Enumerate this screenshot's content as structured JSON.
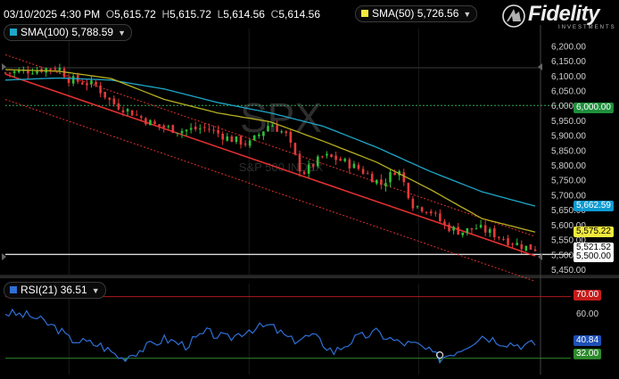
{
  "header": {
    "datetime": "03/10/2025 4:30 PM",
    "open_label": "O",
    "open": "5,615.72",
    "high_label": "H",
    "high": "5,615.72",
    "low_label": "L",
    "low": "5,614.56",
    "close_label": "C",
    "close": "5,614.56"
  },
  "indicators": {
    "sma50": {
      "label": "SMA(50)",
      "value": "5,726.56",
      "color": "#f2ea3c"
    },
    "sma100": {
      "label": "SMA(100)",
      "value": "5,788.59",
      "color": "#1ea7c9"
    },
    "rsi": {
      "label": "RSI(21)",
      "value": "36.51",
      "color": "#2f6fd6"
    }
  },
  "brand": {
    "name": "Fidelity",
    "tagline": "INVESTMENTS"
  },
  "watermark": {
    "symbol": "SPX",
    "name": "S&P 500 INDEX"
  },
  "price_tags": {
    "level": "6,000.00",
    "sma100": "5,662.59",
    "sma50": "5,575.22",
    "last": "5,521.52",
    "support": "5,500.00"
  },
  "rsi_tags": {
    "overbought": "70.00",
    "current": "40.84",
    "oversold": "32.00"
  },
  "colors": {
    "up": "#2fbf3a",
    "down": "#e23a3a",
    "trend": "#e03030",
    "level_tag": "#1f8f3c",
    "sma100_tag": "#0e9ad1",
    "sma50_tag": "#f2ea3c",
    "overbought_tag": "#c61b1b",
    "oversold_tag": "#2d8a2d"
  },
  "chart_data": {
    "type": "candlestick",
    "price_axis": {
      "ticks": [
        6200,
        6150,
        6100,
        6050,
        6000,
        5950,
        5900,
        5850,
        5800,
        5750,
        5700,
        5650,
        5600,
        5550,
        5500,
        5450
      ],
      "tick_labels": [
        "6,200.00",
        "6,150.00",
        "6,100.00",
        "6,050.00",
        "6,000.00",
        "5,950.00",
        "5,900.00",
        "5,850.00",
        "5,800.00",
        "5,750.00",
        "5,700.00",
        "5,650.00",
        "5,600.00",
        "5,550.00",
        "5,500.00",
        "5,450.00"
      ],
      "range": [
        5432,
        6240
      ]
    },
    "rsi_axis": {
      "ticks": [
        60
      ],
      "tick_labels": [
        "60.00"
      ],
      "range": [
        22,
        78
      ],
      "overbought": 70,
      "oversold": 32
    },
    "horizontal_levels": [
      6000,
      5500
    ],
    "trend_channel": {
      "mid": [
        [
          0,
          6105
        ],
        [
          1,
          5495
        ]
      ],
      "upper": [
        [
          0,
          6170
        ],
        [
          1,
          5560
        ]
      ],
      "lower": [
        [
          0,
          6020
        ],
        [
          1,
          5410
        ]
      ]
    },
    "price_key": [
      [
        0,
        6110
      ],
      [
        0.05,
        6118
      ],
      [
        0.1,
        6128
      ],
      [
        0.12,
        6088
      ],
      [
        0.17,
        6068
      ],
      [
        0.2,
        6010
      ],
      [
        0.24,
        5975
      ],
      [
        0.28,
        5935
      ],
      [
        0.33,
        5915
      ],
      [
        0.38,
        5925
      ],
      [
        0.42,
        5890
      ],
      [
        0.46,
        5870
      ],
      [
        0.5,
        5940
      ],
      [
        0.53,
        5900
      ],
      [
        0.56,
        5770
      ],
      [
        0.6,
        5830
      ],
      [
        0.63,
        5818
      ],
      [
        0.67,
        5785
      ],
      [
        0.71,
        5735
      ],
      [
        0.74,
        5790
      ],
      [
        0.77,
        5665
      ],
      [
        0.8,
        5650
      ],
      [
        0.83,
        5595
      ],
      [
        0.86,
        5575
      ],
      [
        0.89,
        5590
      ],
      [
        0.92,
        5570
      ],
      [
        0.95,
        5545
      ],
      [
        0.98,
        5525
      ],
      [
        1,
        5520
      ]
    ],
    "sma50_key": [
      [
        0,
        6120
      ],
      [
        0.1,
        6115
      ],
      [
        0.2,
        6090
      ],
      [
        0.3,
        6020
      ],
      [
        0.4,
        5975
      ],
      [
        0.5,
        5945
      ],
      [
        0.6,
        5880
      ],
      [
        0.7,
        5810
      ],
      [
        0.8,
        5720
      ],
      [
        0.9,
        5620
      ],
      [
        1,
        5575
      ]
    ],
    "sma100_key": [
      [
        0,
        6085
      ],
      [
        0.1,
        6092
      ],
      [
        0.2,
        6085
      ],
      [
        0.3,
        6055
      ],
      [
        0.4,
        6010
      ],
      [
        0.5,
        5975
      ],
      [
        0.6,
        5930
      ],
      [
        0.7,
        5860
      ],
      [
        0.8,
        5780
      ],
      [
        0.9,
        5710
      ],
      [
        1,
        5662
      ]
    ],
    "rsi_key": [
      [
        0,
        60
      ],
      [
        0.05,
        58
      ],
      [
        0.1,
        50
      ],
      [
        0.12,
        44
      ],
      [
        0.18,
        40
      ],
      [
        0.22,
        32
      ],
      [
        0.26,
        38
      ],
      [
        0.3,
        44
      ],
      [
        0.34,
        40
      ],
      [
        0.38,
        48
      ],
      [
        0.42,
        44
      ],
      [
        0.46,
        50
      ],
      [
        0.5,
        52
      ],
      [
        0.54,
        43
      ],
      [
        0.58,
        46
      ],
      [
        0.62,
        36
      ],
      [
        0.66,
        44
      ],
      [
        0.7,
        48
      ],
      [
        0.74,
        42
      ],
      [
        0.78,
        40
      ],
      [
        0.82,
        32
      ],
      [
        0.86,
        38
      ],
      [
        0.9,
        46
      ],
      [
        0.94,
        42
      ],
      [
        0.98,
        40
      ],
      [
        1,
        41
      ]
    ]
  }
}
